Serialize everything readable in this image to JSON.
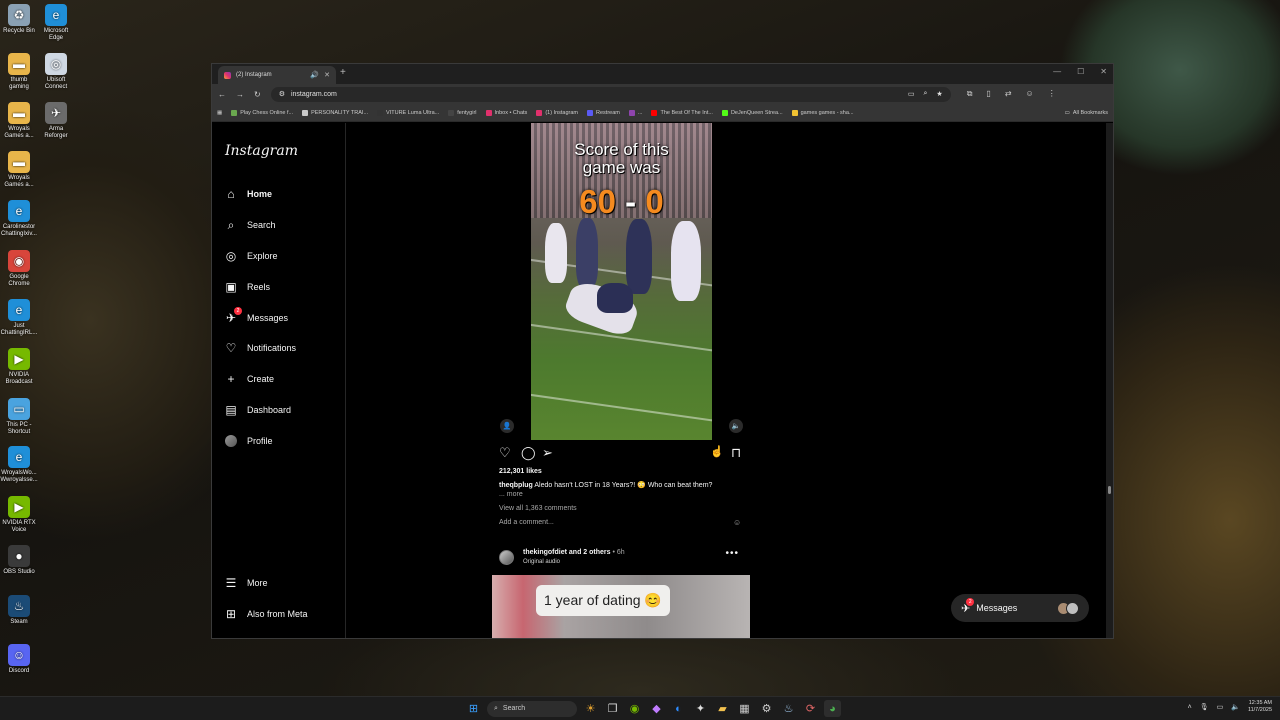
{
  "desktop": {
    "icons": [
      {
        "label": "Recycle Bin",
        "icon": "recycle-bin-icon"
      },
      {
        "label": "Microsoft Edge",
        "icon": "edge-icon"
      },
      {
        "label": "thumb gaming",
        "icon": "folder-icon"
      },
      {
        "label": "Ubisoft Connect",
        "icon": "ubisoft-icon"
      },
      {
        "label": "Wroyals Games a...",
        "icon": "folder-icon"
      },
      {
        "label": "Arma Reforger",
        "icon": "arma-icon"
      },
      {
        "label": "Wroyals Games a...",
        "icon": "folder-icon"
      },
      {
        "label": "Carolinestor ChattingIxiv...",
        "icon": "edge-icon"
      },
      {
        "label": "Google Chrome",
        "icon": "chrome-icon"
      },
      {
        "label": "Just ChattingIRL...",
        "icon": "edge-icon"
      },
      {
        "label": "NVIDIA Broadcast",
        "icon": "nvidia-icon"
      },
      {
        "label": "This PC - Shortcut",
        "icon": "pc-icon"
      },
      {
        "label": "WroyalsWo... Wwroyalsse...",
        "icon": "edge-icon"
      },
      {
        "label": "NVIDIA RTX Voice",
        "icon": "nvidia-icon"
      },
      {
        "label": "OBS Studio",
        "icon": "obs-icon"
      },
      {
        "label": "Steam",
        "icon": "steam-icon"
      },
      {
        "label": "Discord",
        "icon": "discord-icon"
      }
    ]
  },
  "browser": {
    "tab_title": "(2) Instagram",
    "url": "instagram.com",
    "bookmarks": [
      {
        "label": "Play Chess Online f...",
        "color": "#6aa84f"
      },
      {
        "label": "PERSONALITY TRAI...",
        "color": "#c9c9c9"
      },
      {
        "label": "VITURE Luma Ultra...",
        "color": "#333333"
      },
      {
        "label": "fentygirl",
        "color": "#444444"
      },
      {
        "label": "Inbox • Chats",
        "color": "#e1306c"
      },
      {
        "label": "(1) Instagram",
        "color": "#e1306c"
      },
      {
        "label": "Restream",
        "color": "#5a5af5"
      },
      {
        "label": "...",
        "color": "#8e44ad"
      },
      {
        "label": "The Best Of The Int...",
        "color": "#ff0000"
      },
      {
        "label": "DeJenQueen Strea...",
        "color": "#53fc18"
      },
      {
        "label": "games games - sha...",
        "color": "#f1c232"
      }
    ],
    "all_bookmarks": "All Bookmarks"
  },
  "instagram": {
    "logo": "Instagram",
    "nav": [
      {
        "label": "Home",
        "icon": "home-icon",
        "glyph": "⌂"
      },
      {
        "label": "Search",
        "icon": "search-icon",
        "glyph": "⌕"
      },
      {
        "label": "Explore",
        "icon": "compass-icon",
        "glyph": "◎"
      },
      {
        "label": "Reels",
        "icon": "reels-icon",
        "glyph": "▣"
      },
      {
        "label": "Messages",
        "icon": "messenger-icon",
        "glyph": "✈",
        "badge": "2"
      },
      {
        "label": "Notifications",
        "icon": "heart-icon",
        "glyph": "♡"
      },
      {
        "label": "Create",
        "icon": "plus-icon",
        "glyph": "+"
      },
      {
        "label": "Dashboard",
        "icon": "dashboard-icon",
        "glyph": "▤"
      },
      {
        "label": "Profile",
        "icon": "avatar-icon",
        "glyph": ""
      }
    ],
    "more": "More",
    "also_from_meta": "Also from Meta",
    "post1": {
      "overlay_line1": "Score of this",
      "overlay_line2": "game was",
      "score_left": "60",
      "score_dash": "-",
      "score_right": "0",
      "likes": "212,301 likes",
      "username": "theqbplug",
      "caption": "Aledo hasn't LOST in 18 Years?! 😳 Who can beat them?",
      "more": "... more",
      "view_comments": "View all 1,363 comments",
      "add_comment": "Add a comment..."
    },
    "post2": {
      "username": "thekingofdiet",
      "others": "and 2 others",
      "time": "• 6h",
      "audio": "Original audio",
      "overlay": "1 year of dating 😊"
    },
    "messages_pill": {
      "label": "Messages",
      "badge": "2"
    }
  },
  "taskbar": {
    "search": "Search",
    "time": "12:35 AM",
    "date": "11/7/2025"
  }
}
